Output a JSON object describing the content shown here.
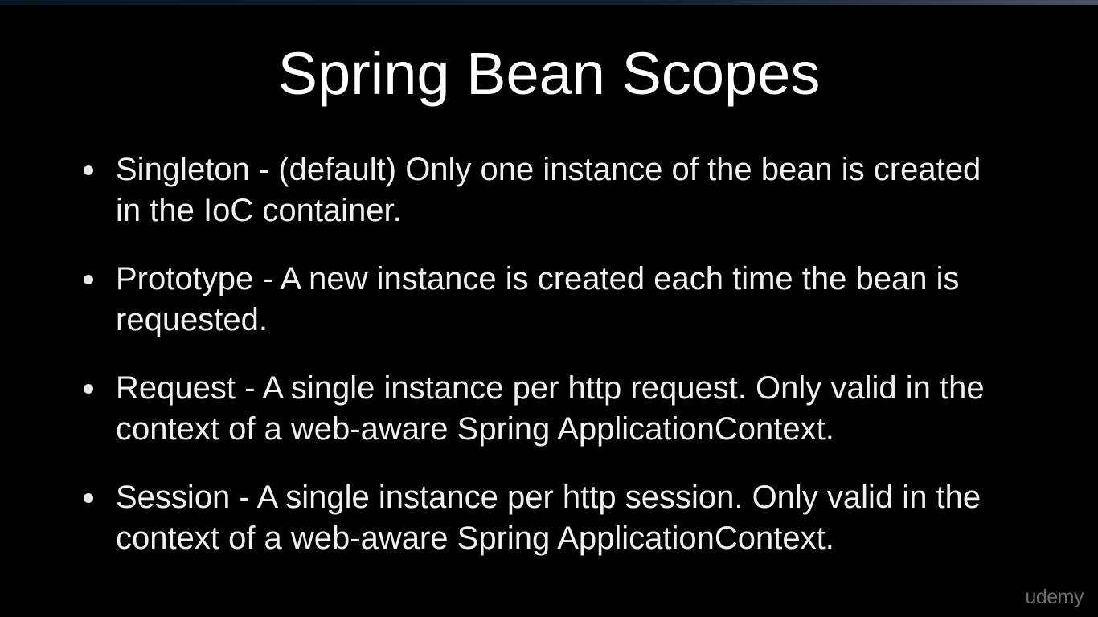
{
  "slide": {
    "title": "Spring Bean Scopes",
    "bullets": [
      {
        "text": "Singleton - (default) Only one instance of the bean is created in the IoC container."
      },
      {
        "text": "Prototype - A new instance is created each time the bean is requested."
      },
      {
        "text": "Request - A single instance per http request. Only valid in the context of a web-aware Spring ApplicationContext."
      },
      {
        "text": "Session - A single instance per http session. Only valid in the context of a web-aware Spring ApplicationContext."
      }
    ],
    "watermark": "udemy"
  },
  "colors": {
    "background": "#000000",
    "text": "#f0f0f0",
    "watermark": "#6e6e6e"
  }
}
